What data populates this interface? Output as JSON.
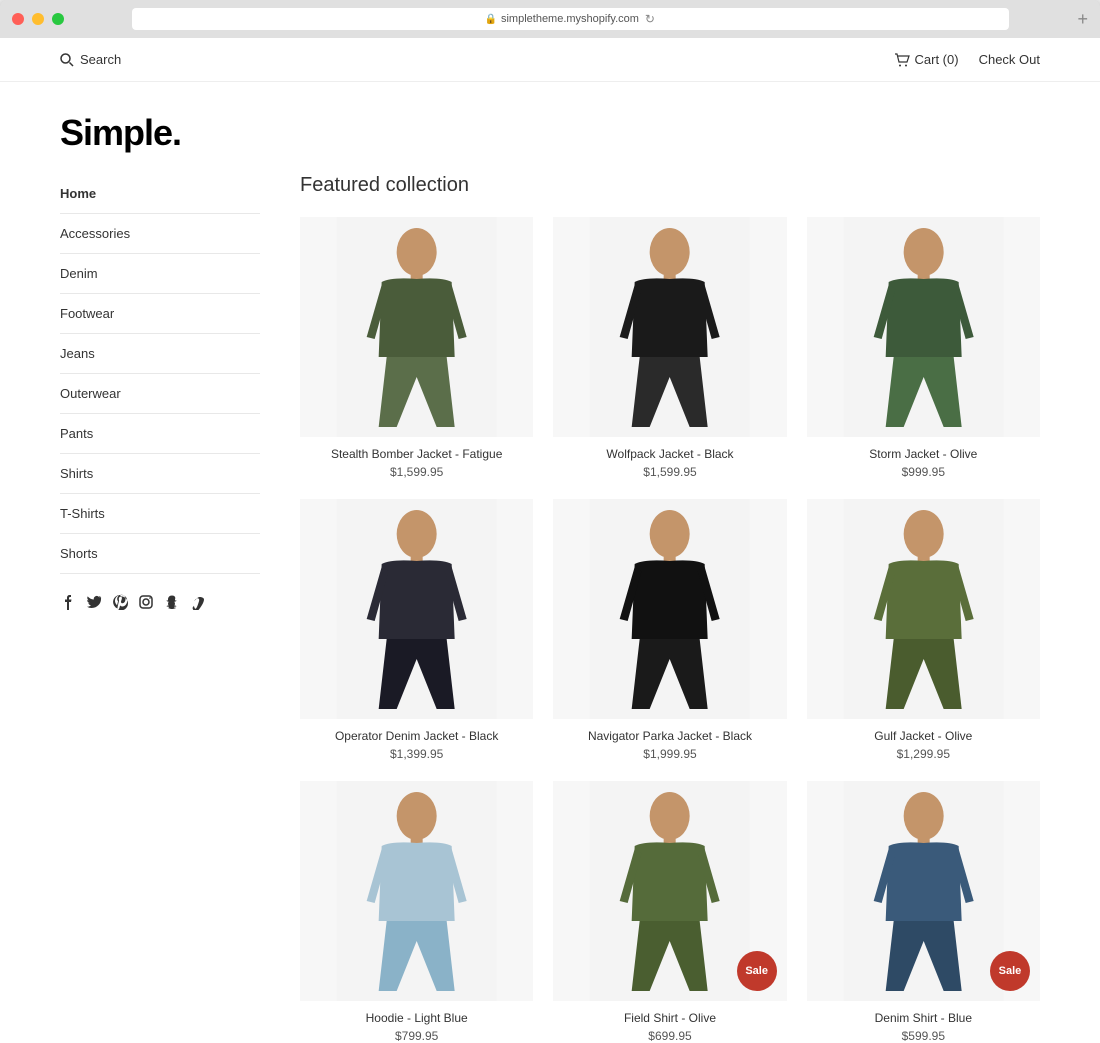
{
  "browser": {
    "url": "simpletheme.myshopify.com",
    "buttons": [
      "close",
      "minimize",
      "maximize"
    ],
    "new_tab_label": "+"
  },
  "header": {
    "search_placeholder": "Search",
    "cart_label": "Cart (0)",
    "checkout_label": "Check Out",
    "logo": "Simple."
  },
  "sidebar": {
    "nav_items": [
      {
        "label": "Home",
        "active": true
      },
      {
        "label": "Accessories",
        "active": false
      },
      {
        "label": "Denim",
        "active": false
      },
      {
        "label": "Footwear",
        "active": false
      },
      {
        "label": "Jeans",
        "active": false
      },
      {
        "label": "Outerwear",
        "active": false
      },
      {
        "label": "Pants",
        "active": false
      },
      {
        "label": "Shirts",
        "active": false
      },
      {
        "label": "T-Shirts",
        "active": false
      },
      {
        "label": "Shorts",
        "active": false
      }
    ],
    "social_icons": [
      "facebook",
      "twitter",
      "pinterest",
      "instagram",
      "snapchat",
      "vimeo"
    ]
  },
  "collection": {
    "title": "Featured collection",
    "products": [
      {
        "name": "Stealth Bomber Jacket - Fatigue",
        "price": "$1,599.95",
        "sale": false,
        "color_top": "#4a5c3a",
        "color_bottom": "#5b6e4a",
        "icon": "🧥"
      },
      {
        "name": "Wolfpack Jacket - Black",
        "price": "$1,599.95",
        "sale": false,
        "color_top": "#1a1a1a",
        "color_bottom": "#2a2a2a",
        "icon": "🧥"
      },
      {
        "name": "Storm Jacket - Olive",
        "price": "$999.95",
        "sale": false,
        "color_top": "#3d5a3a",
        "color_bottom": "#4a6e45",
        "icon": "🧥"
      },
      {
        "name": "Operator Denim Jacket - Black",
        "price": "$1,399.95",
        "sale": false,
        "color_top": "#2a2a35",
        "color_bottom": "#1a1a25",
        "icon": "🧥"
      },
      {
        "name": "Navigator Parka Jacket - Black",
        "price": "$1,999.95",
        "sale": false,
        "color_top": "#111111",
        "color_bottom": "#1a1a1a",
        "icon": "🧥"
      },
      {
        "name": "Gulf Jacket - Olive",
        "price": "$1,299.95",
        "sale": false,
        "color_top": "#5a6e3a",
        "color_bottom": "#4a5c2e",
        "icon": "🧥"
      },
      {
        "name": "Hoodie - Light Blue",
        "price": "$799.95",
        "sale": false,
        "color_top": "#a8c4d4",
        "color_bottom": "#8ab2c8",
        "icon": "👕"
      },
      {
        "name": "Field Shirt - Olive",
        "price": "$699.95",
        "sale": true,
        "color_top": "#556b3a",
        "color_bottom": "#4a5e30",
        "icon": "👕"
      },
      {
        "name": "Denim Shirt - Blue",
        "price": "$599.95",
        "sale": true,
        "color_top": "#3a5a7a",
        "color_bottom": "#2e4a65",
        "icon": "👕"
      }
    ]
  },
  "labels": {
    "sale": "Sale"
  }
}
